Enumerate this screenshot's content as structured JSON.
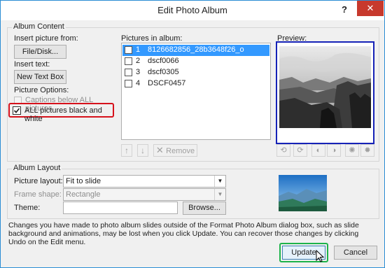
{
  "dialog": {
    "title": "Edit Photo Album",
    "help": "?",
    "close": "✕"
  },
  "album_content": {
    "legend": "Album Content",
    "insert_picture_from": "Insert picture from:",
    "file_disk_button": "File/Disk...",
    "insert_text": "Insert text:",
    "new_text_box_button": "New Text Box",
    "picture_options": "Picture Options:",
    "captions_below_all": "Captions below ALL pictures",
    "all_black_white": "ALL pictures black and white"
  },
  "pictures": {
    "label": "Pictures in album:",
    "items": [
      {
        "num": "1",
        "name": "8126682856_28b3648f26_o"
      },
      {
        "num": "2",
        "name": "dscf0066"
      },
      {
        "num": "3",
        "name": "dscf0305"
      },
      {
        "num": "4",
        "name": "DSCF0457"
      }
    ],
    "remove_button": "Remove"
  },
  "preview": {
    "label": "Preview:"
  },
  "album_layout": {
    "legend": "Album Layout",
    "picture_layout_label": "Picture layout:",
    "picture_layout_value": "Fit to slide",
    "frame_shape_label": "Frame shape:",
    "frame_shape_value": "Rectangle",
    "theme_label": "Theme:",
    "theme_value": "",
    "browse_button": "Browse..."
  },
  "notice": "Changes you have made to photo album slides outside of the Format Photo Album dialog box, such as slide background and animations, may be lost when you click Update. You can recover those changes by clicking Undo on the Edit menu.",
  "footer": {
    "update_button": "Update",
    "cancel_button": "Cancel"
  },
  "colors": {
    "highlight_red": "#d6111b",
    "highlight_blue": "#1622b7",
    "highlight_green": "#1db34a",
    "selection": "#3399ff",
    "close_red": "#c7392d"
  }
}
